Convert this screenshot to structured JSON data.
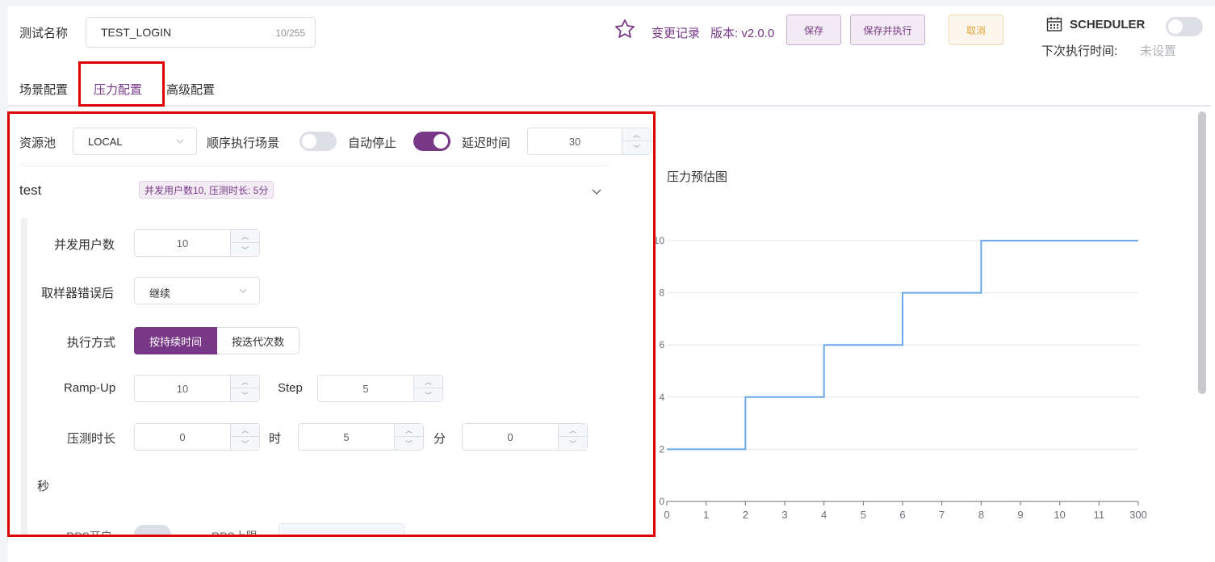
{
  "header": {
    "name_label": "测试名称",
    "name_value": "TEST_LOGIN",
    "name_count": "10/255",
    "history_label": "变更记录",
    "version_text": "版本: v2.0.0",
    "save_label": "保存",
    "save_run_label": "保存并执行",
    "cancel_label": "取消",
    "scheduler_label": "SCHEDULER",
    "scheduler_enabled": false,
    "next_run_label": "下次执行时间:",
    "next_run_value": "未设置"
  },
  "tabs": [
    {
      "label": "场景配置",
      "active": false
    },
    {
      "label": "压力配置",
      "active": true
    },
    {
      "label": "高级配置",
      "active": false
    }
  ],
  "config": {
    "pool_label": "资源池",
    "pool_value": "LOCAL",
    "serial_label": "顺序执行场景",
    "serial_on": false,
    "auto_stop_label": "自动停止",
    "auto_stop_on": true,
    "delay_label": "延迟时间",
    "delay_value": "30"
  },
  "thread_group": {
    "name": "test",
    "summary_tag": "并发用户数10, 压测时长: 5分",
    "concurrency_label": "并发用户数",
    "concurrency_value": "10",
    "on_error_label": "取样器错误后",
    "on_error_value": "继续",
    "exec_mode_label": "执行方式",
    "exec_mode_options": [
      "按持续时间",
      "按迭代次数"
    ],
    "exec_mode_selected": "按持续时间",
    "rampup_label": "Ramp-Up",
    "rampup_value": "10",
    "step_label": "Step",
    "step_value": "5",
    "duration_label": "压测时长",
    "hours_value": "0",
    "hours_unit": "时",
    "minutes_value": "5",
    "minutes_unit": "分",
    "seconds_value": "0",
    "seconds_unit": "秒",
    "rps_label": "RPS开启",
    "rps_limit_label": "RPS上限"
  },
  "chart_data": {
    "type": "line",
    "title": "压力预估图",
    "step": true,
    "categories": [
      "0",
      "1",
      "2",
      "3",
      "4",
      "5",
      "6",
      "7",
      "8",
      "9",
      "10",
      "11",
      "300"
    ],
    "y_ticks": [
      "0",
      "2",
      "4",
      "6",
      "8",
      "10"
    ],
    "ylim": [
      0,
      10
    ],
    "series": [
      {
        "values": [
          2,
          2,
          4,
          4,
          6,
          6,
          8,
          8,
          10,
          10,
          10,
          10,
          10
        ]
      }
    ],
    "color": "#6aa8e8",
    "grid": true
  },
  "colors": {
    "accent": "#783887",
    "warning": "#e6a23c",
    "highlight": "#e00000"
  }
}
